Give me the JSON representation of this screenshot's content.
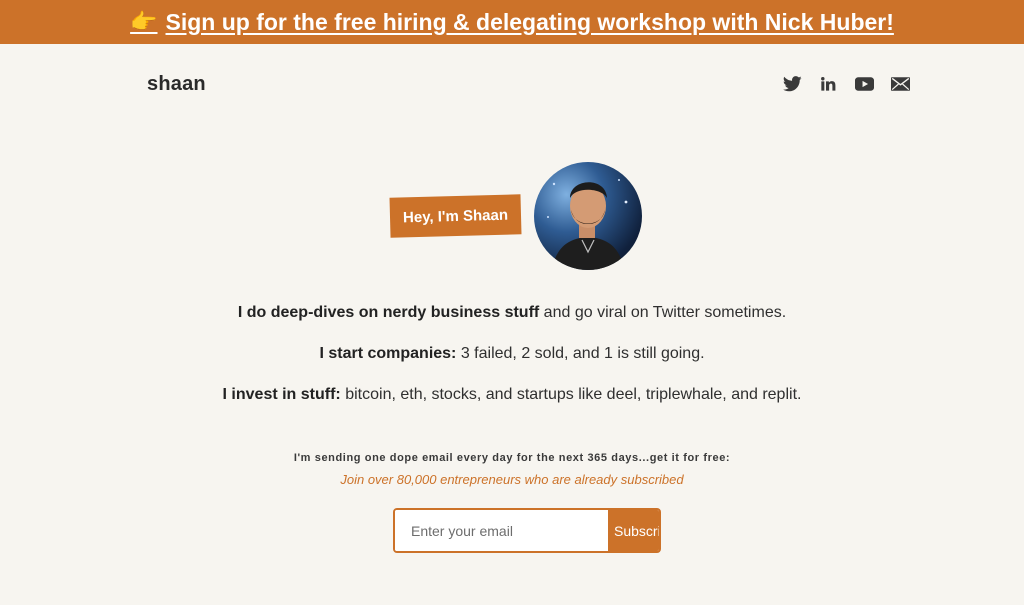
{
  "banner": {
    "emoji": "👉",
    "text": "Sign up for the free hiring & delegating workshop with Nick Huber!"
  },
  "header": {
    "logo": "shaan",
    "social_icons": [
      "twitter-icon",
      "linkedin-icon",
      "youtube-icon",
      "mail-icon"
    ]
  },
  "hero": {
    "tag": "Hey, I'm Shaan"
  },
  "intro": [
    {
      "bold": "I do deep-dives on nerdy business stuff",
      "rest": " and go viral on Twitter sometimes."
    },
    {
      "bold": "I start companies:",
      "rest": " 3 failed, 2 sold, and 1 is still going."
    },
    {
      "bold": "I invest in stuff:",
      "rest": " bitcoin, eth, stocks, and startups like deel, triplewhale, and replit."
    }
  ],
  "newsletter": {
    "pitch": "I'm sending one dope email every day for the next 365 days...get it for free:",
    "social_proof": "Join over 80,000 entrepreneurs who are already subscribed",
    "email_placeholder": "Enter your email",
    "subscribe_label": "Subscribe"
  },
  "colors": {
    "accent": "#cc7229",
    "background": "#f7f5f0",
    "text": "#2b2b2b"
  }
}
